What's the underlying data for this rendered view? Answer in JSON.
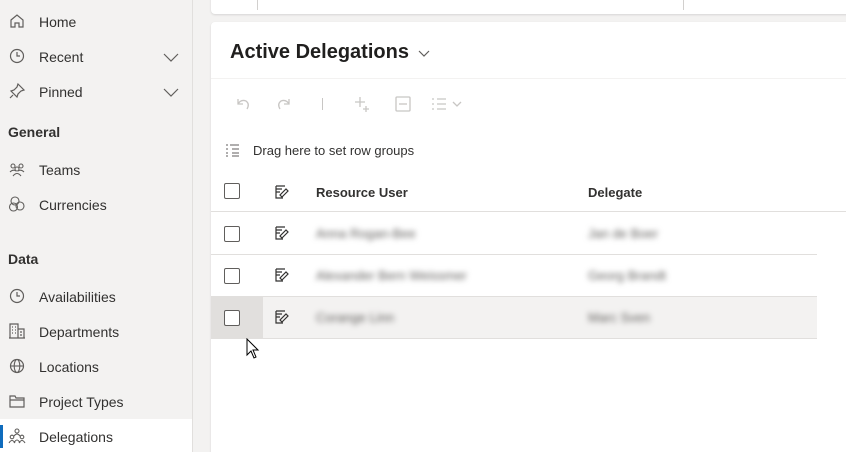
{
  "sidebar": {
    "items_top": [
      {
        "label": "Home",
        "icon": "home-icon"
      },
      {
        "label": "Recent",
        "icon": "clock-icon"
      },
      {
        "label": "Pinned",
        "icon": "pin-icon"
      }
    ],
    "sections": [
      {
        "title": "General",
        "items": [
          {
            "label": "Teams",
            "icon": "teams-icon"
          },
          {
            "label": "Currencies",
            "icon": "currencies-icon"
          }
        ]
      },
      {
        "title": "Data",
        "items": [
          {
            "label": "Availabilities",
            "icon": "clock-icon"
          },
          {
            "label": "Departments",
            "icon": "building-icon"
          },
          {
            "label": "Locations",
            "icon": "globe-icon"
          },
          {
            "label": "Project Types",
            "icon": "folder-icon"
          },
          {
            "label": "Delegations",
            "icon": "delegation-icon",
            "active": true
          }
        ]
      }
    ]
  },
  "main": {
    "title": "Active Delegations",
    "group_hint": "Drag here to set row groups",
    "columns": [
      "Resource User",
      "Delegate"
    ],
    "rows": [
      {
        "resource_user": "Anna Rogan-Bee",
        "delegate": "Jan de Boer"
      },
      {
        "resource_user": "Alexander Bern Weissmer",
        "delegate": "Georg Brandt"
      },
      {
        "resource_user": "Corange Linn",
        "delegate": "Marc Sven"
      }
    ]
  },
  "colors": {
    "accent": "#0f6cbd",
    "sidebar_bg": "#f3f2f1",
    "panel_bg": "#ffffff"
  }
}
